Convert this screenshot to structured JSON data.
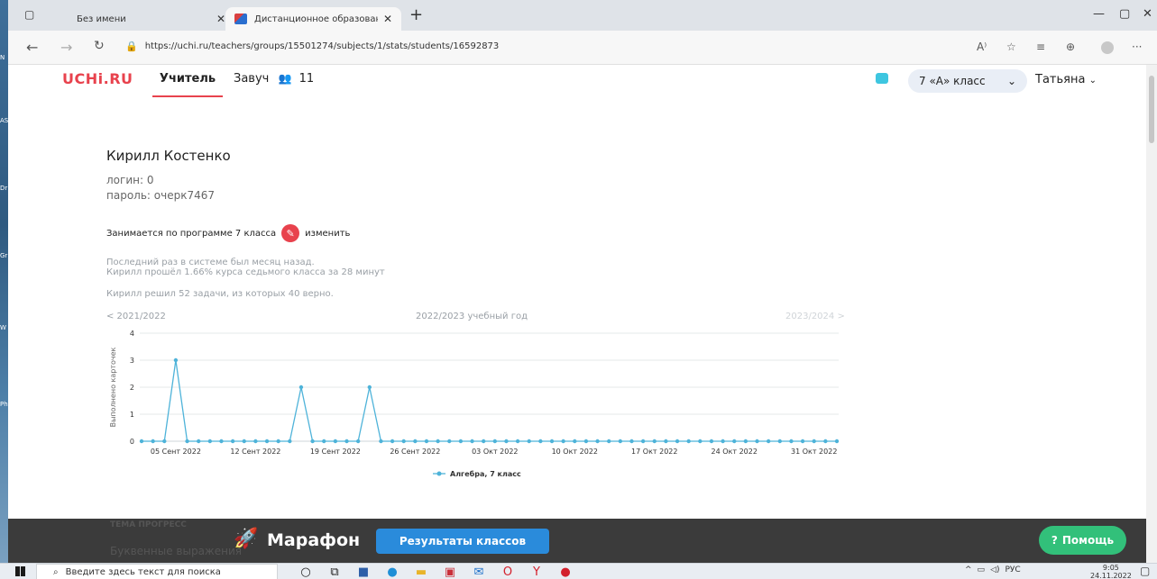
{
  "browser": {
    "tabs": [
      {
        "title": "Без имени",
        "active": false
      },
      {
        "title": "Дистанционное образование д",
        "active": true
      }
    ],
    "url": "https://uchi.ru/teachers/groups/15501274/subjects/1/stats/students/16592873",
    "reader_label": "A⁾"
  },
  "site": {
    "logo": "UCHi.RU",
    "nav": {
      "teacher": "Учитель",
      "deputy": "Завуч",
      "deputy_count": "11"
    },
    "class_select": "7 «А» класс",
    "user": "Татьяна"
  },
  "student": {
    "name": "Кирилл Костенко",
    "login": "логин: 0",
    "password": "пароль: очерк7467",
    "program": "Занимается по программе 7 класса",
    "edit": "изменить",
    "last_seen": "Последний раз в системе был месяц назад.",
    "progress": "Кирилл прошёл 1.66% курса седьмого класса за 28 минут",
    "solved": "Кирилл решил 52 задачи, из которых 40 верно."
  },
  "year_nav": {
    "prev": "< 2021/2022",
    "current": "2022/2023 учебный год",
    "next": "2023/2024 >"
  },
  "chart_data": {
    "type": "line",
    "title": "",
    "ylabel": "Выполнено карточек",
    "xlabel": "",
    "ylim": [
      0,
      4
    ],
    "yticks": [
      0,
      1,
      2,
      3,
      4
    ],
    "xtick_labels": [
      "05 Сент 2022",
      "12 Сент 2022",
      "19 Сент 2022",
      "26 Сент 2022",
      "03 Окт 2022",
      "10 Окт 2022",
      "17 Окт 2022",
      "24 Окт 2022",
      "31 Окт 2022"
    ],
    "legend_position": "bottom",
    "grid": true,
    "series": [
      {
        "name": "Алгебра, 7 класс",
        "color": "#4eb3d9",
        "values": [
          0,
          0,
          0,
          3,
          0,
          0,
          0,
          0,
          0,
          0,
          0,
          0,
          0,
          0,
          2,
          0,
          0,
          0,
          0,
          0,
          2,
          0,
          0,
          0,
          0,
          0,
          0,
          0,
          0,
          0,
          0,
          0,
          0,
          0,
          0,
          0,
          0,
          0,
          0,
          0,
          0,
          0,
          0,
          0,
          0,
          0,
          0,
          0,
          0,
          0,
          0,
          0,
          0,
          0,
          0,
          0,
          0,
          0,
          0,
          0,
          0,
          0
        ]
      }
    ]
  },
  "marathon": {
    "behind_header": "ТЕМА   ПРОГРЕСС",
    "behind_row": "Буквенные выражения",
    "title": "Марафон",
    "results_button": "Результаты классов",
    "help_button": "Помощь"
  },
  "taskbar": {
    "search_placeholder": "Введите здесь текст для поиска",
    "lang": "РУС",
    "time": "9:05",
    "date": "24.11.2022"
  }
}
